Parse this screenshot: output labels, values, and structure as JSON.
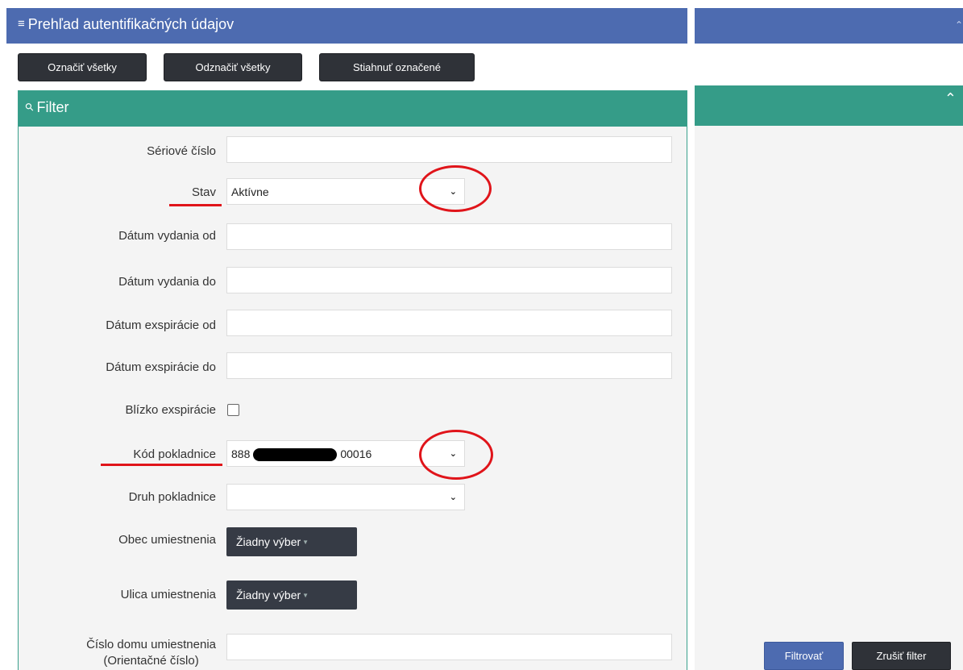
{
  "header": {
    "title": "Prehľad autentifikačných údajov",
    "menu_icon": "hamburger-icon"
  },
  "toolbar": {
    "select_all": "Označiť všetky",
    "deselect_all": "Odznačiť všetky",
    "download_selected": "Stiahnuť označené"
  },
  "filter": {
    "title": "Filter",
    "fields": {
      "serial": "Sériové číslo",
      "status": "Stav",
      "status_value": "Aktívne",
      "issued_from": "Dátum vydania od",
      "issued_to": "Dátum vydania do",
      "expiry_from": "Dátum exspirácie od",
      "expiry_to": "Dátum exspirácie do",
      "near_expiry": "Blízko exspirácie",
      "register_code": "Kód pokladnice",
      "register_code_value_prefix": "888",
      "register_code_value_suffix": "00016",
      "register_type": "Druh pokladnice",
      "municipality": "Obec umiestnenia",
      "municipality_value": "Žiadny výber",
      "street": "Ulica umiestnenia",
      "street_value": "Žiadny výber",
      "house_number_line1": "Číslo domu umiestnenia",
      "house_number_line2": "(Orientačné číslo)"
    },
    "apply": "Filtrovať",
    "cancel": "Zrušiť filter"
  },
  "colors": {
    "header_blue": "#4d6bb0",
    "panel_teal": "#359c88",
    "dark_button": "#2f3238",
    "primary_button": "#4d6bb0",
    "annotation_red": "#e0141a"
  }
}
